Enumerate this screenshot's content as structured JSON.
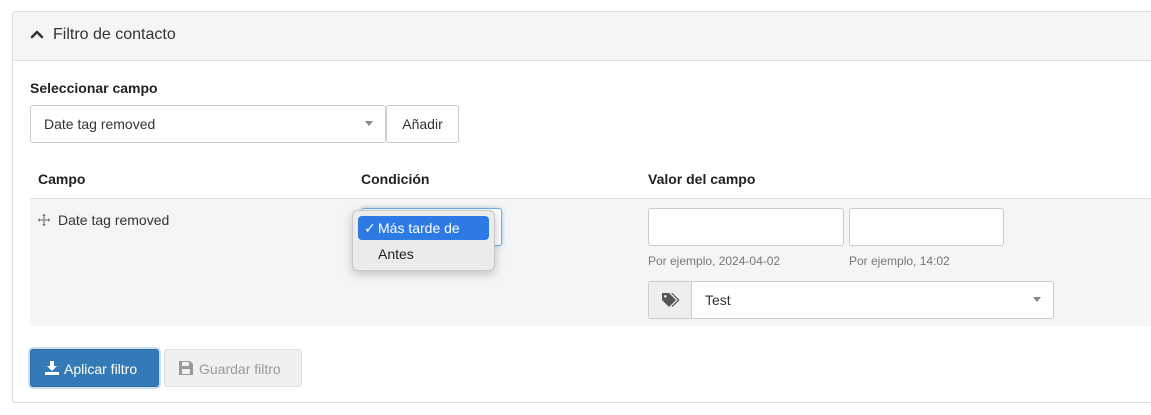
{
  "panel": {
    "title": "Filtro de contacto",
    "toggle_icon": "chevron-up-icon"
  },
  "field_selector": {
    "label": "Seleccionar campo",
    "selected": "Date tag removed",
    "add_button": "Añadir"
  },
  "table": {
    "headers": {
      "field": "Campo",
      "condition": "Condición",
      "value": "Valor del campo"
    },
    "rows": [
      {
        "field": "Date tag removed",
        "drag_icon": "move-icon",
        "condition": {
          "options": [
            {
              "label": "Más tarde de",
              "selected": true,
              "check": "✓"
            },
            {
              "label": "Antes",
              "selected": false
            }
          ]
        },
        "date": {
          "value": "",
          "hint": "Por ejemplo, 2024-04-02"
        },
        "time": {
          "value": "",
          "hint": "Por ejemplo, 14:02"
        },
        "tag": {
          "icon": "tags-icon",
          "selected": "Test"
        }
      }
    ]
  },
  "actions": {
    "apply": {
      "label": "Aplicar filtro",
      "icon": "download-icon"
    },
    "save": {
      "label": "Guardar filtro",
      "icon": "floppy-icon",
      "disabled": true
    }
  },
  "colors": {
    "primary": "#337ab7",
    "dropdown_highlight": "#2d7ae5",
    "row_background": "#f5f5f5"
  }
}
